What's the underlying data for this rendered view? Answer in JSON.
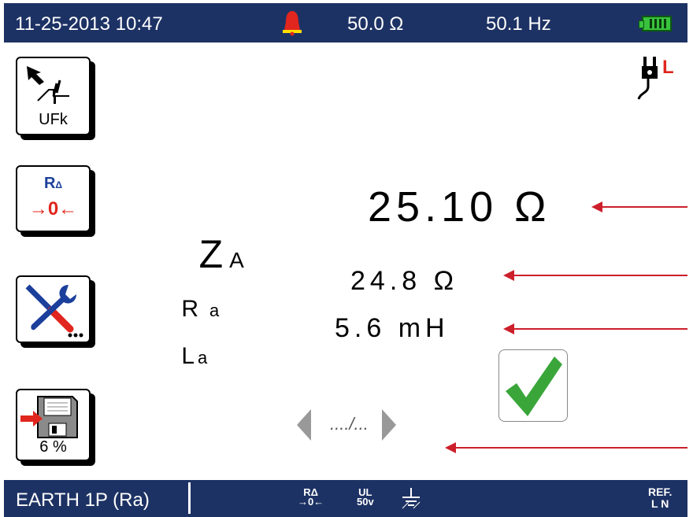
{
  "status_bar": {
    "date_time": "11-25-2013 10:47",
    "impedance": "50.0 Ω",
    "frequency": "50.1 Hz",
    "alarm_icon": "bell-warning-icon",
    "battery_icon": "battery-full-icon",
    "colors": {
      "bar": "#1d3264",
      "alarm": "#e0261e",
      "battery": "#39c23e"
    }
  },
  "sidebar": {
    "ufk_button": {
      "label": "UFk",
      "icon": "ufk-curve-icon"
    },
    "zero_button": {
      "label": "R",
      "sub": "Δ",
      "icon_text": "→0←"
    },
    "settings_button": {
      "icon": "tools-icon"
    },
    "save_button": {
      "label": "6 %",
      "icon": "floppy-save-icon"
    }
  },
  "plug_indicator": {
    "icon": "plug-icon",
    "label": "L",
    "color": "#e0261e"
  },
  "measurements": {
    "za": {
      "symbol": "Z",
      "sub": "A",
      "value": "25.10 Ω"
    },
    "ra": {
      "symbol": "R",
      "sub": "a",
      "value": "24.8 Ω"
    },
    "la": {
      "symbol": "L",
      "sub": "a",
      "value": "5.6 mH"
    }
  },
  "result": {
    "icon": "check-pass-icon",
    "color": "#3aa63a"
  },
  "nav": {
    "prev_icon": "triangle-left-icon",
    "next_icon": "triangle-right-icon",
    "mid_glyph": "..../..."
  },
  "bottom_bar": {
    "mode_label": "EARTH 1P (Ra)",
    "icon1_top": "RΔ",
    "icon1_bottom": "→0←",
    "icon2_top": "UL",
    "icon2_bottom": "50v",
    "icon3": "earth-icon",
    "ref_top": "REF.",
    "ref_bottom": "L N"
  },
  "annotation_color": "#cc1f2b"
}
